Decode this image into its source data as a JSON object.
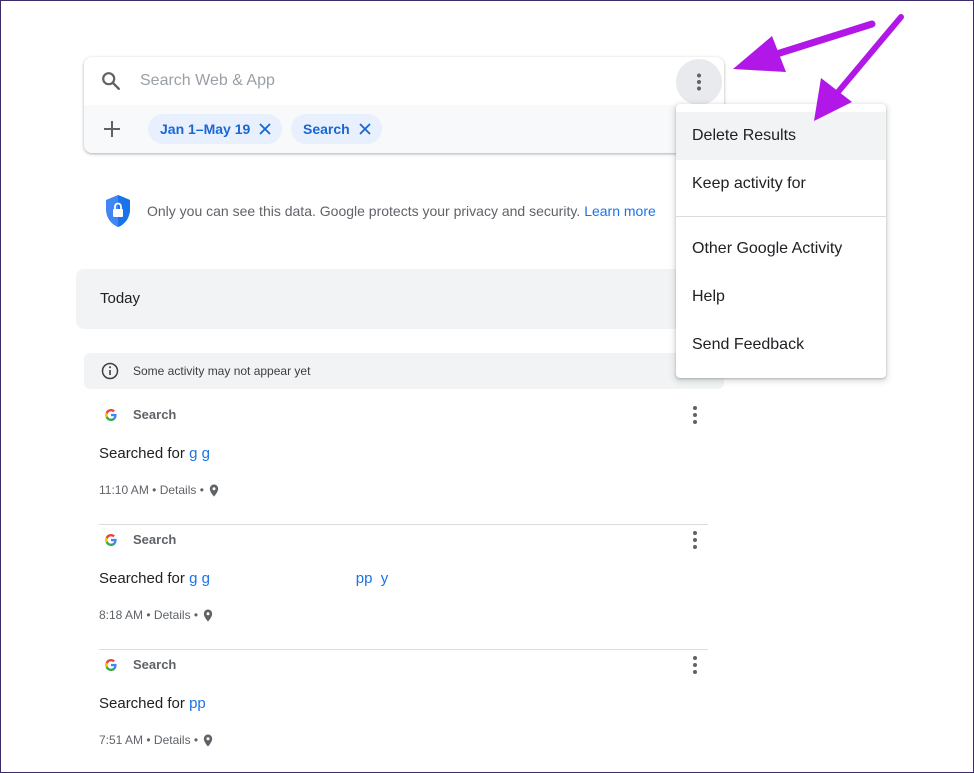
{
  "search": {
    "placeholder": "Search Web & App",
    "chips": [
      {
        "label": "Jan 1–May 19"
      },
      {
        "label": "Search"
      }
    ]
  },
  "privacy": {
    "text": "Only you can see this data. Google protects your privacy and security.",
    "link": "Learn more"
  },
  "today": {
    "label": "Today"
  },
  "notice": {
    "text": "Some activity may not appear yet"
  },
  "activity": [
    {
      "product": "Search",
      "searched_prefix": "Searched for",
      "query": "g g",
      "time": "11:10 AM",
      "details": "Details"
    },
    {
      "product": "Search",
      "searched_prefix": "Searched for",
      "query": "g g                                   pp  y",
      "time": "8:18 AM",
      "details": "Details"
    },
    {
      "product": "Search",
      "searched_prefix": "Searched for",
      "query": "pp",
      "time": "7:51 AM",
      "details": "Details"
    }
  ],
  "menu": {
    "items": [
      {
        "label": "Delete Results"
      },
      {
        "label": "Keep activity for"
      },
      {
        "label": "Other Google Activity"
      },
      {
        "label": "Help"
      },
      {
        "label": "Send Feedback"
      }
    ]
  },
  "colors": {
    "accent": "#1a73e8",
    "chip_bg": "#e8f0fe",
    "annotation_arrow": "#b118e8"
  },
  "icons": [
    "search-icon",
    "more-vert-icon",
    "add-icon",
    "close-icon",
    "shield-lock-icon",
    "info-icon",
    "google-g-icon",
    "location-pin-icon"
  ]
}
